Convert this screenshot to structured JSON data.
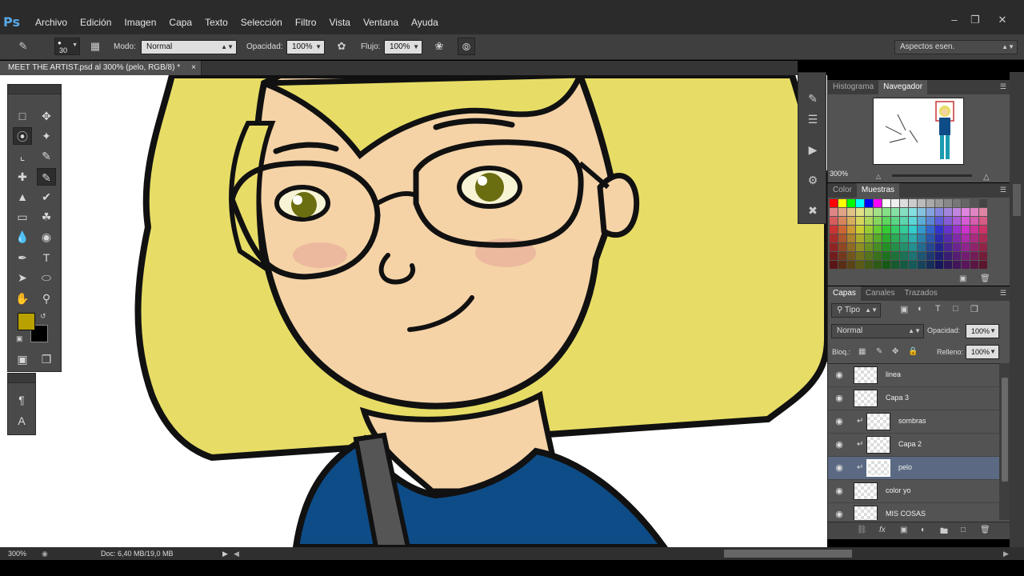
{
  "app": {
    "logo": "Ps"
  },
  "menu": [
    "Archivo",
    "Edición",
    "Imagen",
    "Capa",
    "Texto",
    "Selección",
    "Filtro",
    "Vista",
    "Ventana",
    "Ayuda"
  ],
  "options": {
    "brush_size": "30",
    "mode_label": "Modo:",
    "mode_value": "Normal",
    "opacity_label": "Opacidad:",
    "opacity_value": "100%",
    "flow_label": "Flujo:",
    "flow_value": "100%",
    "workspace": "Aspectos esen."
  },
  "document": {
    "tab_title": "MEET THE ARTIST.psd al 300% (pelo, RGB/8) *",
    "close": "×"
  },
  "status": {
    "zoom": "300%",
    "doc": "Doc: 6,40 MB/19,0 MB"
  },
  "navigator": {
    "tabs": [
      "Histograma",
      "Navegador"
    ],
    "zoom": "300%"
  },
  "color_panel": {
    "tabs": [
      "Color",
      "Muestras"
    ]
  },
  "colors": {
    "foreground": "#b8a100",
    "background": "#000000",
    "hair": "#e8df6a",
    "skin": "#f5d3a6",
    "shirt": "#0e4c87"
  },
  "layers_panel": {
    "tabs": [
      "Capas",
      "Canales",
      "Trazados"
    ],
    "filter": "Tipo",
    "blend_mode": "Normal",
    "opacity_label": "Opacidad:",
    "opacity_value": "100%",
    "lock_label": "Bloq.:",
    "fill_label": "Relleno:",
    "fill_value": "100%",
    "layers": [
      {
        "name": "linea",
        "clipped": false,
        "selected": false
      },
      {
        "name": "Capa 3",
        "clipped": false,
        "selected": false
      },
      {
        "name": "sombras",
        "clipped": true,
        "selected": false
      },
      {
        "name": "Capa 2",
        "clipped": true,
        "selected": false
      },
      {
        "name": "pelo",
        "clipped": true,
        "selected": true
      },
      {
        "name": "color yo",
        "clipped": false,
        "selected": false
      },
      {
        "name": "MIS COSAS",
        "clipped": false,
        "selected": false
      }
    ]
  }
}
